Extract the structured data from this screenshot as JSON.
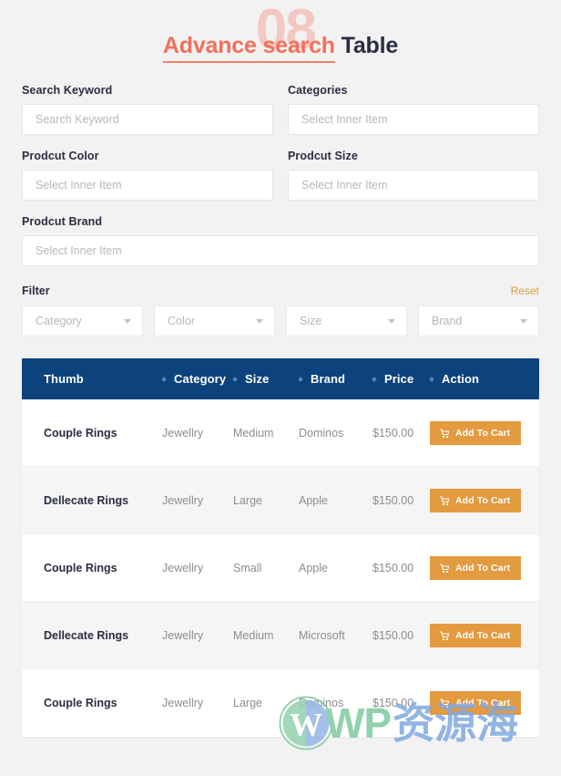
{
  "header": {
    "ghost_number": "08",
    "title_highlight": "Advance search",
    "title_rest": "Table"
  },
  "form": {
    "fields": [
      {
        "label": "Search Keyword",
        "placeholder": "Search Keyword",
        "value": ""
      },
      {
        "label": "Categories",
        "placeholder": "Select Inner Item",
        "value": ""
      },
      {
        "label": "Prodcut Color",
        "placeholder": "Select Inner Item",
        "value": ""
      },
      {
        "label": "Prodcut Size",
        "placeholder": "Select Inner Item",
        "value": ""
      },
      {
        "label": "Prodcut Brand",
        "placeholder": "Select Inner Item",
        "value": ""
      }
    ]
  },
  "filter": {
    "title": "Filter",
    "reset_label": "Reset",
    "selects": [
      {
        "placeholder": "Category",
        "value": ""
      },
      {
        "placeholder": "Color",
        "value": ""
      },
      {
        "placeholder": "Size",
        "value": ""
      },
      {
        "placeholder": "Brand",
        "value": ""
      }
    ]
  },
  "table": {
    "columns": [
      "Thumb",
      "Category",
      "Size",
      "Brand",
      "Price",
      "Action"
    ],
    "action_label": "Add To Cart",
    "rows": [
      {
        "thumb": "Couple Rings",
        "category": "Jewellry",
        "size": "Medium",
        "brand": "Dominos",
        "price": "$150.00",
        "action": "Add To Cart"
      },
      {
        "thumb": "Dellecate Rings",
        "category": "Jewellry",
        "size": "Large",
        "brand": "Apple",
        "price": "$150.00",
        "action": "Add To Cart"
      },
      {
        "thumb": "Couple Rings",
        "category": "Jewellry",
        "size": "Small",
        "brand": "Apple",
        "price": "$150.00",
        "action": "Add To Cart"
      },
      {
        "thumb": "Dellecate Rings",
        "category": "Jewellry",
        "size": "Medium",
        "brand": "Microsoft",
        "price": "$150.00",
        "action": "Add To Cart"
      },
      {
        "thumb": "Couple Rings",
        "category": "Jewellry",
        "size": "Large",
        "brand": "Dominos",
        "price": "$150.00",
        "action": "Add To Cart"
      }
    ]
  },
  "watermark": {
    "text_latin": "WP",
    "text_cjk": "资源海"
  },
  "colors": {
    "page_bg": "#f2f2f2",
    "accent_coral": "#f4705a",
    "header_navy": "#0c437d",
    "button_orange": "#e49a3f",
    "reset_gold": "#d9a23f"
  }
}
